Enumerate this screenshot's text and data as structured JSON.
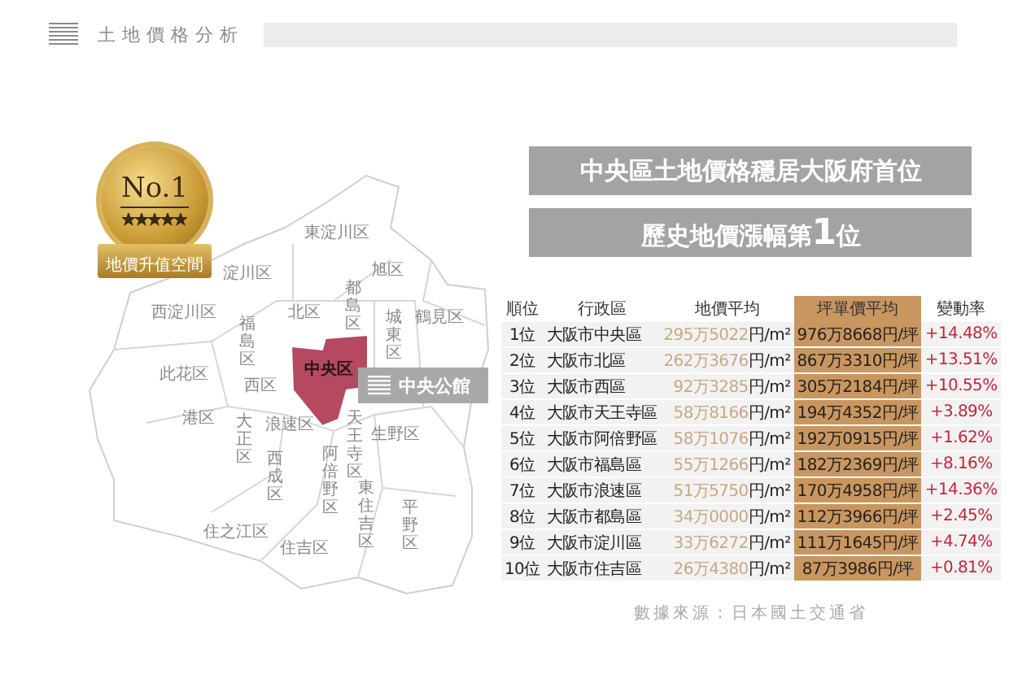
{
  "header": {
    "title": "土地價格分析"
  },
  "medal": {
    "title": "No.1",
    "stars": 5,
    "ribbon": "地價升值空間"
  },
  "map": {
    "districts": [
      {
        "name": "東淀川区",
        "selected": false
      },
      {
        "name": "淀川区",
        "selected": false
      },
      {
        "name": "旭区",
        "selected": false
      },
      {
        "name": "西淀川区",
        "selected": false
      },
      {
        "name": "福島区",
        "selected": false
      },
      {
        "name": "北区",
        "selected": false
      },
      {
        "name": "都島区",
        "selected": false
      },
      {
        "name": "城東区",
        "selected": false
      },
      {
        "name": "鶴見区",
        "selected": false
      },
      {
        "name": "此花区",
        "selected": false
      },
      {
        "name": "西区",
        "selected": false
      },
      {
        "name": "中央区",
        "selected": true
      },
      {
        "name": "港区",
        "selected": false
      },
      {
        "name": "大正区",
        "selected": false
      },
      {
        "name": "浪速区",
        "selected": false
      },
      {
        "name": "天王寺区",
        "selected": false
      },
      {
        "name": "生野区",
        "selected": false
      },
      {
        "name": "西成区",
        "selected": false
      },
      {
        "name": "阿倍野区",
        "selected": false
      },
      {
        "name": "住之江区",
        "selected": false
      },
      {
        "name": "住吉区",
        "selected": false
      },
      {
        "name": "東住吉区",
        "selected": false
      },
      {
        "name": "平野区",
        "selected": false
      }
    ],
    "callout": "中央公館"
  },
  "headlines": [
    "中央區土地價格穩居大阪府首位",
    "歷史地價漲幅第**1**位"
  ],
  "table": {
    "columns": [
      "順位",
      "行政區",
      "地價平均",
      "坪單價平均",
      "變動率"
    ],
    "rows": [
      {
        "rank": "1位",
        "district": "大阪市中央區",
        "land_price": {
          "amount": "295万5022",
          "unit": "円/m²"
        },
        "tsubo_price": "976万8668円/坪",
        "change": "+14.48%"
      },
      {
        "rank": "2位",
        "district": "大阪市北區",
        "land_price": {
          "amount": "262万3676",
          "unit": "円/m²"
        },
        "tsubo_price": "867万3310円/坪",
        "change": "+13.51%"
      },
      {
        "rank": "3位",
        "district": "大阪市西區",
        "land_price": {
          "amount": "92万3285",
          "unit": "円/m²"
        },
        "tsubo_price": "305万2184円/坪",
        "change": "+10.55%"
      },
      {
        "rank": "4位",
        "district": "大阪市天王寺區",
        "land_price": {
          "amount": "58万8166",
          "unit": "円/m²"
        },
        "tsubo_price": "194万4352円/坪",
        "change": "+3.89%"
      },
      {
        "rank": "5位",
        "district": "大阪市阿倍野區",
        "land_price": {
          "amount": "58万1076",
          "unit": "円/m²"
        },
        "tsubo_price": "192万0915円/坪",
        "change": "+1.62%"
      },
      {
        "rank": "6位",
        "district": "大阪市福島區",
        "land_price": {
          "amount": "55万1266",
          "unit": "円/m²"
        },
        "tsubo_price": "182万2369円/坪",
        "change": "+8.16%"
      },
      {
        "rank": "7位",
        "district": "大阪市浪速區",
        "land_price": {
          "amount": "51万5750",
          "unit": "円/m²"
        },
        "tsubo_price": "170万4958円/坪",
        "change": "+14.36%"
      },
      {
        "rank": "8位",
        "district": "大阪市都島區",
        "land_price": {
          "amount": "34万0000",
          "unit": "円/m²"
        },
        "tsubo_price": "112万3966円/坪",
        "change": "+2.45%"
      },
      {
        "rank": "9位",
        "district": "大阪市淀川區",
        "land_price": {
          "amount": "33万6272",
          "unit": "円/m²"
        },
        "tsubo_price": "111万1645円/坪",
        "change": "+4.74%"
      },
      {
        "rank": "10位",
        "district": "大阪市住吉區",
        "land_price": {
          "amount": "26万4380",
          "unit": "円/m²"
        },
        "tsubo_price": "87万3986円/坪",
        "change": "+0.81%"
      }
    ]
  },
  "source": "數據來源：日本國土交通省"
}
